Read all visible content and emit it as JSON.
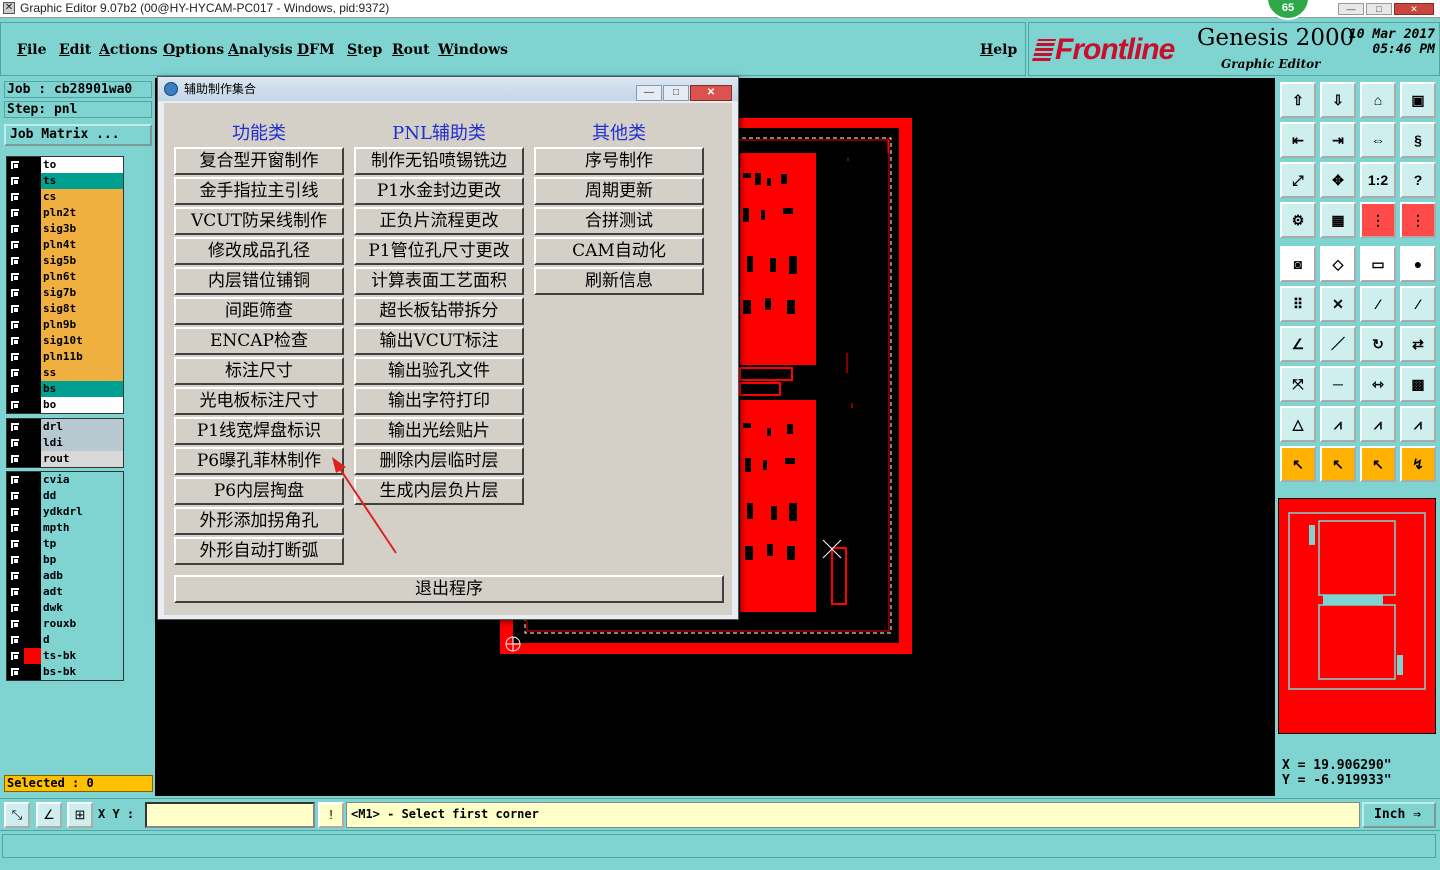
{
  "window": {
    "title": "Graphic Editor 9.07b2 (00@HY-HYCAM-PC017 - Windows, pid:9372)",
    "badge": "65"
  },
  "menu": [
    "File",
    "Edit",
    "Actions",
    "Options",
    "Analysis",
    "DFM",
    "Step",
    "Rout",
    "Windows"
  ],
  "help": "Help",
  "brand": {
    "logo": "Frontline",
    "product": "Genesis 2000",
    "subtitle": "Graphic Editor",
    "date": "10 Mar 2017",
    "time": "05:46 PM"
  },
  "left": {
    "job": "Job : cb28901wa0",
    "step": "Step: pnl",
    "job_matrix": "Job Matrix ...",
    "selected": "Selected : 0"
  },
  "layers_board": [
    {
      "name": "to",
      "color": "#ffffff"
    },
    {
      "name": "ts",
      "color": "#00a090"
    },
    {
      "name": "cs",
      "color": "#f0b040"
    },
    {
      "name": "pln2t",
      "color": "#f0b040"
    },
    {
      "name": "sig3b",
      "color": "#f0b040"
    },
    {
      "name": "pln4t",
      "color": "#f0b040"
    },
    {
      "name": "sig5b",
      "color": "#f0b040"
    },
    {
      "name": "pln6t",
      "color": "#f0b040"
    },
    {
      "name": "sig7b",
      "color": "#f0b040"
    },
    {
      "name": "sig8t",
      "color": "#f0b040"
    },
    {
      "name": "pln9b",
      "color": "#f0b040"
    },
    {
      "name": "sig10t",
      "color": "#f0b040"
    },
    {
      "name": "pln11b",
      "color": "#f0b040"
    },
    {
      "name": "ss",
      "color": "#f0b040"
    },
    {
      "name": "bs",
      "color": "#00a090"
    },
    {
      "name": "bo",
      "color": "#ffffff"
    }
  ],
  "layers_drill": [
    {
      "name": "drl",
      "color": "#b8c8d0"
    },
    {
      "name": "ldi",
      "color": "#b8c8d0"
    },
    {
      "name": "rout",
      "color": "#d8d8d8"
    }
  ],
  "layers_misc": [
    {
      "name": "cvia",
      "color": "#7fd3d0",
      "swatch": "#000000"
    },
    {
      "name": "dd",
      "color": "#7fd3d0",
      "swatch": "#000000"
    },
    {
      "name": "ydkdrl",
      "color": "#7fd3d0",
      "swatch": "#000000"
    },
    {
      "name": "mpth",
      "color": "#7fd3d0",
      "swatch": "#000000"
    },
    {
      "name": "tp",
      "color": "#7fd3d0",
      "swatch": "#000000"
    },
    {
      "name": "bp",
      "color": "#7fd3d0",
      "swatch": "#000000"
    },
    {
      "name": "adb",
      "color": "#7fd3d0",
      "swatch": "#000000"
    },
    {
      "name": "adt",
      "color": "#7fd3d0",
      "swatch": "#000000"
    },
    {
      "name": "dwk",
      "color": "#7fd3d0",
      "swatch": "#000000"
    },
    {
      "name": "rouxb",
      "color": "#7fd3d0",
      "swatch": "#000000"
    },
    {
      "name": "d",
      "color": "#7fd3d0",
      "swatch": "#000000"
    },
    {
      "name": "ts-bk",
      "color": "#7fd3d0",
      "swatch": "#ff0000"
    },
    {
      "name": "bs-bk",
      "color": "#7fd3d0",
      "swatch": "#000000"
    }
  ],
  "dialog": {
    "title": "辅助制作集合",
    "columns": [
      "功能类",
      "PNL辅助类",
      "其他类"
    ],
    "col1": [
      "复合型开窗制作",
      "金手指拉主引线",
      "VCUT防呆线制作",
      "修改成品孔径",
      "内层错位铺铜",
      "间距筛查",
      "ENCAP检查",
      "标注尺寸",
      "光电板标注尺寸",
      "P1线宽焊盘标识",
      "P6曝孔菲林制作",
      "P6内层掏盘",
      "外形添加拐角孔",
      "外形自动打断弧"
    ],
    "col2": [
      "制作无铅喷锡铣边",
      "P1水金封边更改",
      "正负片流程更改",
      "P1管位孔尺寸更改",
      "计算表面工艺面积",
      "超长板钻带拆分",
      "输出VCUT标注",
      "输出验孔文件",
      "输出字符打印",
      "输出光绘贴片",
      "删除内层临时层",
      "生成内层负片层"
    ],
    "col3": [
      "序号制作",
      "周期更新",
      "合拼测试",
      "CAM自动化",
      "刷新信息"
    ],
    "exit": "退出程序"
  },
  "coords": {
    "x": "X = 19.906290\"",
    "y": "Y = -6.919933\""
  },
  "bottom": {
    "xy_label": "X Y :",
    "xy_value": "",
    "prompt": "<M1> - Select first corner",
    "unit": "Inch"
  },
  "tools": [
    "home-top-icon",
    "home-bottom-icon",
    "home-icon",
    "panel-icon",
    "left-arrow-icon",
    "right-arrow-icon",
    "swap-icon",
    "s-shape-icon",
    "zoom-fit-icon",
    "zoom-center-icon",
    "scale-1-2-icon",
    "help-icon",
    "measure-icon",
    "grid-icon",
    "layer-red-icon",
    "layer-red2-icon",
    "snap-icon",
    "shape-icon",
    "ruler-icon",
    "point-icon",
    "connect-icon",
    "cross-icon",
    "line-pt-icon",
    "line-pt2-icon",
    "line-icon",
    "line2-icon",
    "arc-icon",
    "flip-icon",
    "move-icon",
    "minus-icon",
    "dim-icon",
    "group-icon",
    "triangle-icon",
    "tri2-icon",
    "tri3-icon",
    "tri4-icon",
    "select-icon",
    "select-box-icon",
    "select-circle-icon",
    "select-path-icon"
  ],
  "tool_labels": {
    "scale": "1:2",
    "help": "?"
  },
  "colors": {
    "accent": "#7fd3d0",
    "pcb": "#ff0000",
    "dialog_heading": "#1f2fd0",
    "selected_bg": "#ffc000",
    "prompt_bg": "#ffffc8"
  }
}
